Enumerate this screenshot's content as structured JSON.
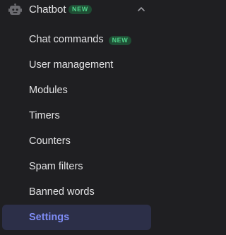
{
  "section": {
    "title": "Chatbot",
    "badge": "NEW",
    "icon": "robot-icon",
    "chevron_icon": "chevron-up-icon"
  },
  "items": [
    {
      "label": "Chat commands",
      "badge": "NEW"
    },
    {
      "label": "User management"
    },
    {
      "label": "Modules"
    },
    {
      "label": "Timers"
    },
    {
      "label": "Counters"
    },
    {
      "label": "Spam filters"
    },
    {
      "label": "Banned words"
    },
    {
      "label": "Settings",
      "active": true
    }
  ],
  "colors": {
    "background": "#1f1f22",
    "text": "#e4e4e6",
    "accent": "#7e8cf5",
    "active_background": "#2c2f48",
    "badge_background": "#1f4d34",
    "badge_text": "#4fd38a"
  }
}
